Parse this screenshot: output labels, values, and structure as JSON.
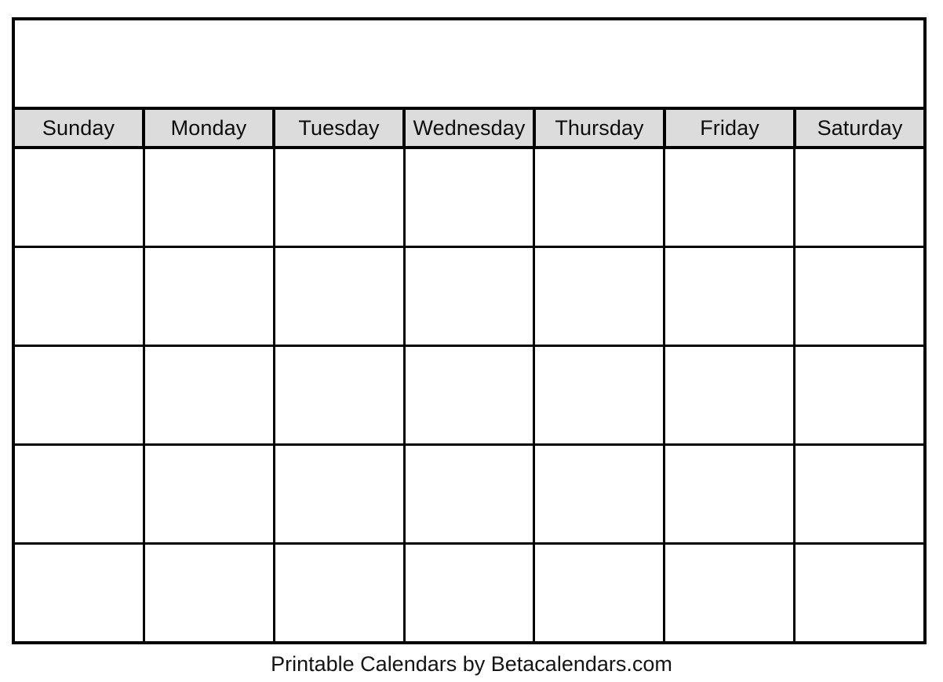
{
  "document": {
    "kind": "blank-printable-monthly-calendar",
    "page_background": "#ffffff"
  },
  "calendar": {
    "title": "",
    "week_start": "Sunday",
    "header_background": "#dcdcdc",
    "border_color": "#000000",
    "cell_background": "#ffffff",
    "weekdays": [
      {
        "label": "Sunday"
      },
      {
        "label": "Monday"
      },
      {
        "label": "Tuesday"
      },
      {
        "label": "Wednesday"
      },
      {
        "label": "Thursday"
      },
      {
        "label": "Friday"
      },
      {
        "label": "Saturday"
      }
    ],
    "weeks": [
      {
        "days": [
          {
            "number": ""
          },
          {
            "number": ""
          },
          {
            "number": ""
          },
          {
            "number": ""
          },
          {
            "number": ""
          },
          {
            "number": ""
          },
          {
            "number": ""
          }
        ]
      },
      {
        "days": [
          {
            "number": ""
          },
          {
            "number": ""
          },
          {
            "number": ""
          },
          {
            "number": ""
          },
          {
            "number": ""
          },
          {
            "number": ""
          },
          {
            "number": ""
          }
        ]
      },
      {
        "days": [
          {
            "number": ""
          },
          {
            "number": ""
          },
          {
            "number": ""
          },
          {
            "number": ""
          },
          {
            "number": ""
          },
          {
            "number": ""
          },
          {
            "number": ""
          }
        ]
      },
      {
        "days": [
          {
            "number": ""
          },
          {
            "number": ""
          },
          {
            "number": ""
          },
          {
            "number": ""
          },
          {
            "number": ""
          },
          {
            "number": ""
          },
          {
            "number": ""
          }
        ]
      },
      {
        "days": [
          {
            "number": ""
          },
          {
            "number": ""
          },
          {
            "number": ""
          },
          {
            "number": ""
          },
          {
            "number": ""
          },
          {
            "number": ""
          },
          {
            "number": ""
          }
        ]
      }
    ]
  },
  "footer": {
    "credit": "Printable Calendars by Betacalendars.com"
  }
}
